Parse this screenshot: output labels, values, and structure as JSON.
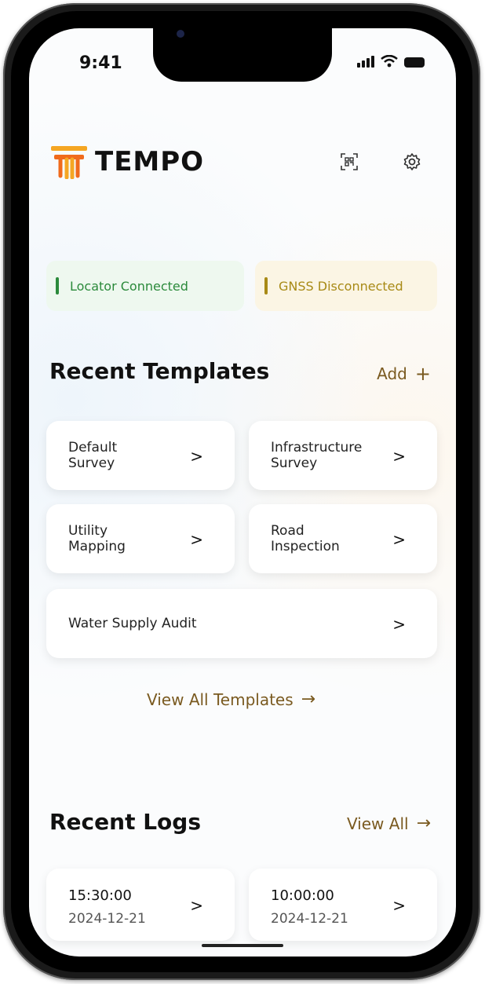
{
  "status_bar": {
    "time": "9:41"
  },
  "header": {
    "brand": "TEMPO",
    "scan_icon": "qr-scan-icon",
    "settings_icon": "gear-icon"
  },
  "colors": {
    "accent": "#7a5a20",
    "logo_orange": "#f06a1c",
    "logo_yellow": "#f5a623",
    "connected": "#2b8a3b",
    "disconnected": "#a88a16"
  },
  "status": {
    "locator": "Locator Connected",
    "gnss": "GNSS Disconnected"
  },
  "templates": {
    "title": "Recent Templates",
    "add_label": "Add",
    "add_icon": "+",
    "items": [
      {
        "label": "Default\nSurvey"
      },
      {
        "label": "Infrastructure\nSurvey"
      },
      {
        "label": "Utility\nMapping"
      },
      {
        "label": "Road\nInspection"
      },
      {
        "label": "Water Supply Audit"
      }
    ],
    "view_all": "View All Templates",
    "arrow": "→"
  },
  "logs": {
    "title": "Recent Logs",
    "view_all": "View All",
    "arrow": "→",
    "items": [
      {
        "time": "15:30:00",
        "date": "2024-12-21"
      },
      {
        "time": "10:00:00",
        "date": "2024-12-21"
      }
    ]
  },
  "chevron": ">"
}
